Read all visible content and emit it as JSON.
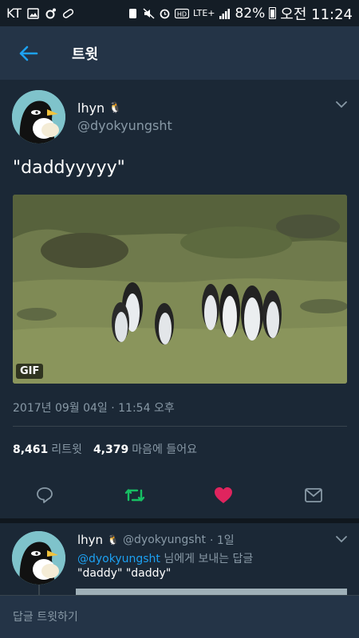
{
  "status_bar": {
    "carrier": "KT",
    "battery": "82%",
    "time": "오전 11:24",
    "network": "LTE+"
  },
  "app_bar": {
    "title": "트윗",
    "back_icon": "arrow-left-icon"
  },
  "tweet": {
    "author_name": "lhyn",
    "author_badge": "🐧",
    "handle": "@dyokyungsht",
    "text": "\"daddyyyyy\"",
    "media": {
      "type": "GIF",
      "badge": "GIF"
    },
    "date": "2017년 09월 04일 · 11:54 오후",
    "retweets_count": "8,461",
    "retweets_label": "리트윗",
    "likes_count": "4,379",
    "likes_label": "마음에 들어요"
  },
  "actions": [
    {
      "name": "reply",
      "icon": "reply-icon"
    },
    {
      "name": "retweet",
      "icon": "retweet-icon",
      "color": "#17bf63"
    },
    {
      "name": "like",
      "icon": "heart-icon",
      "color": "#e0245e"
    },
    {
      "name": "message",
      "icon": "envelope-icon"
    }
  ],
  "reply": {
    "author_name": "lhyn",
    "author_badge": "🐧",
    "handle": "@dyokyungsht",
    "time": "· 1일",
    "to_mention": "@dyokyungsht",
    "to_suffix": " 님에게 보내는 답글",
    "text": "\"daddy\" \"daddy\""
  },
  "composer": {
    "placeholder": "답글 트윗하기"
  },
  "colors": {
    "background": "#1b2836",
    "header": "#243447",
    "accent": "#1da1f2",
    "secondary_text": "#8899a6",
    "retweet": "#17bf63",
    "like": "#e0245e"
  }
}
